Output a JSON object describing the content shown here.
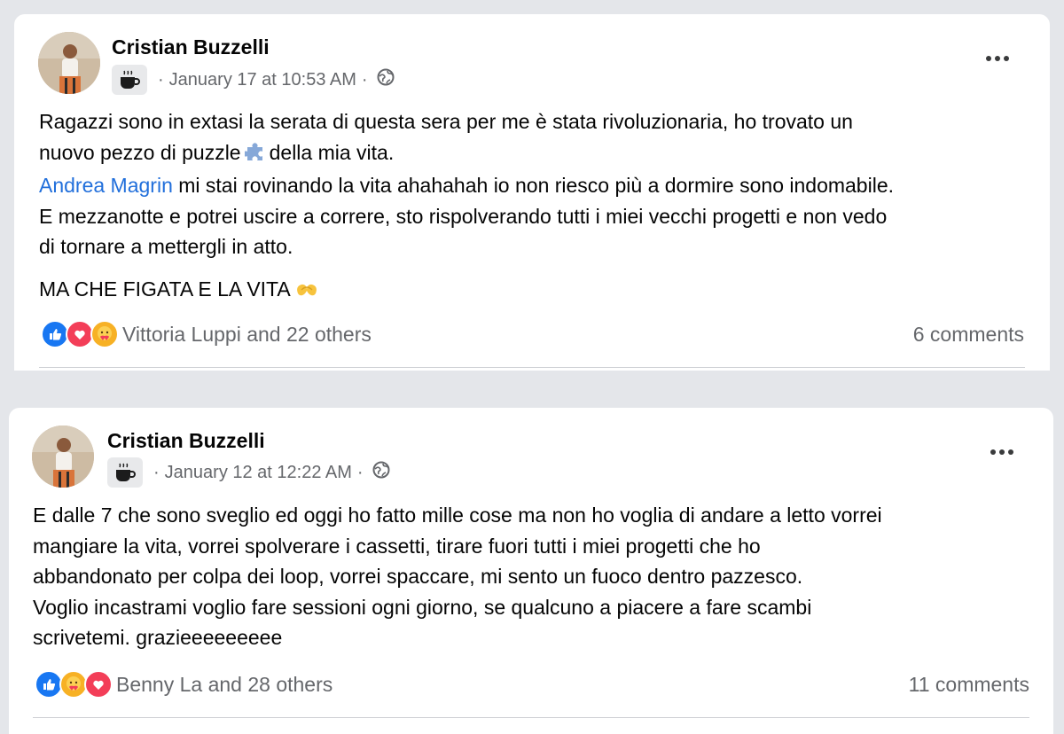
{
  "posts": [
    {
      "author": "Cristian Buzzelli",
      "timestamp": "January 17 at 10:53 AM",
      "separator": "·",
      "badge_icon": "coffee-icon",
      "audience_icon": "globe-icon",
      "body": {
        "line1": "Ragazzi sono in extasi la serata di questa sera per me è stata rivoluzionaria, ho trovato un",
        "line2_before": "nuovo pezzo di puzzle",
        "line2_after": "della mia vita.",
        "mention": "Andrea Magrin",
        "line3_after": " mi stai rovinando la vita ahahahah io non riesco più a dormire sono indomabile.",
        "line4": "E mezzanotte e potrei uscire a correre, sto rispolverando tutti i miei vecchi progetti e non vedo",
        "line5": "di tornare a mettergli in atto.",
        "line6": "MA CHE FIGATA E LA VITA"
      },
      "reactions": [
        "like",
        "love",
        "care"
      ],
      "reaction_text": "Vittoria Luppi and 22 others",
      "comments": "6 comments"
    },
    {
      "author": "Cristian Buzzelli",
      "timestamp": "January 12 at 12:22 AM",
      "separator": "·",
      "badge_icon": "coffee-icon",
      "audience_icon": "globe-icon",
      "body": {
        "line1": "E dalle 7 che sono sveglio ed oggi ho fatto mille cose ma non ho voglia di andare a letto vorrei",
        "line2": "mangiare la vita, vorrei spolverare i cassetti, tirare fuori tutti i miei progetti che ho",
        "line3": "abbandonato per colpa dei loop, vorrei spaccare, mi sento un fuoco dentro pazzesco.",
        "line4": "Voglio incastrami voglio fare sessioni ogni giorno, se qualcuno a piacere a fare scambi",
        "line5": "scrivetemi. grazieeeeeeeee"
      },
      "reactions": [
        "like",
        "care",
        "love"
      ],
      "reaction_text": "Benny La and 28 others",
      "comments": "11 comments"
    }
  ],
  "colors": {
    "background": "#e4e6ea",
    "card": "#ffffff",
    "text_primary": "#050505",
    "text_secondary": "#65676b",
    "mention": "#216fdb",
    "like": "#1877f2",
    "love": "#f33e58",
    "care": "#f7b125"
  }
}
